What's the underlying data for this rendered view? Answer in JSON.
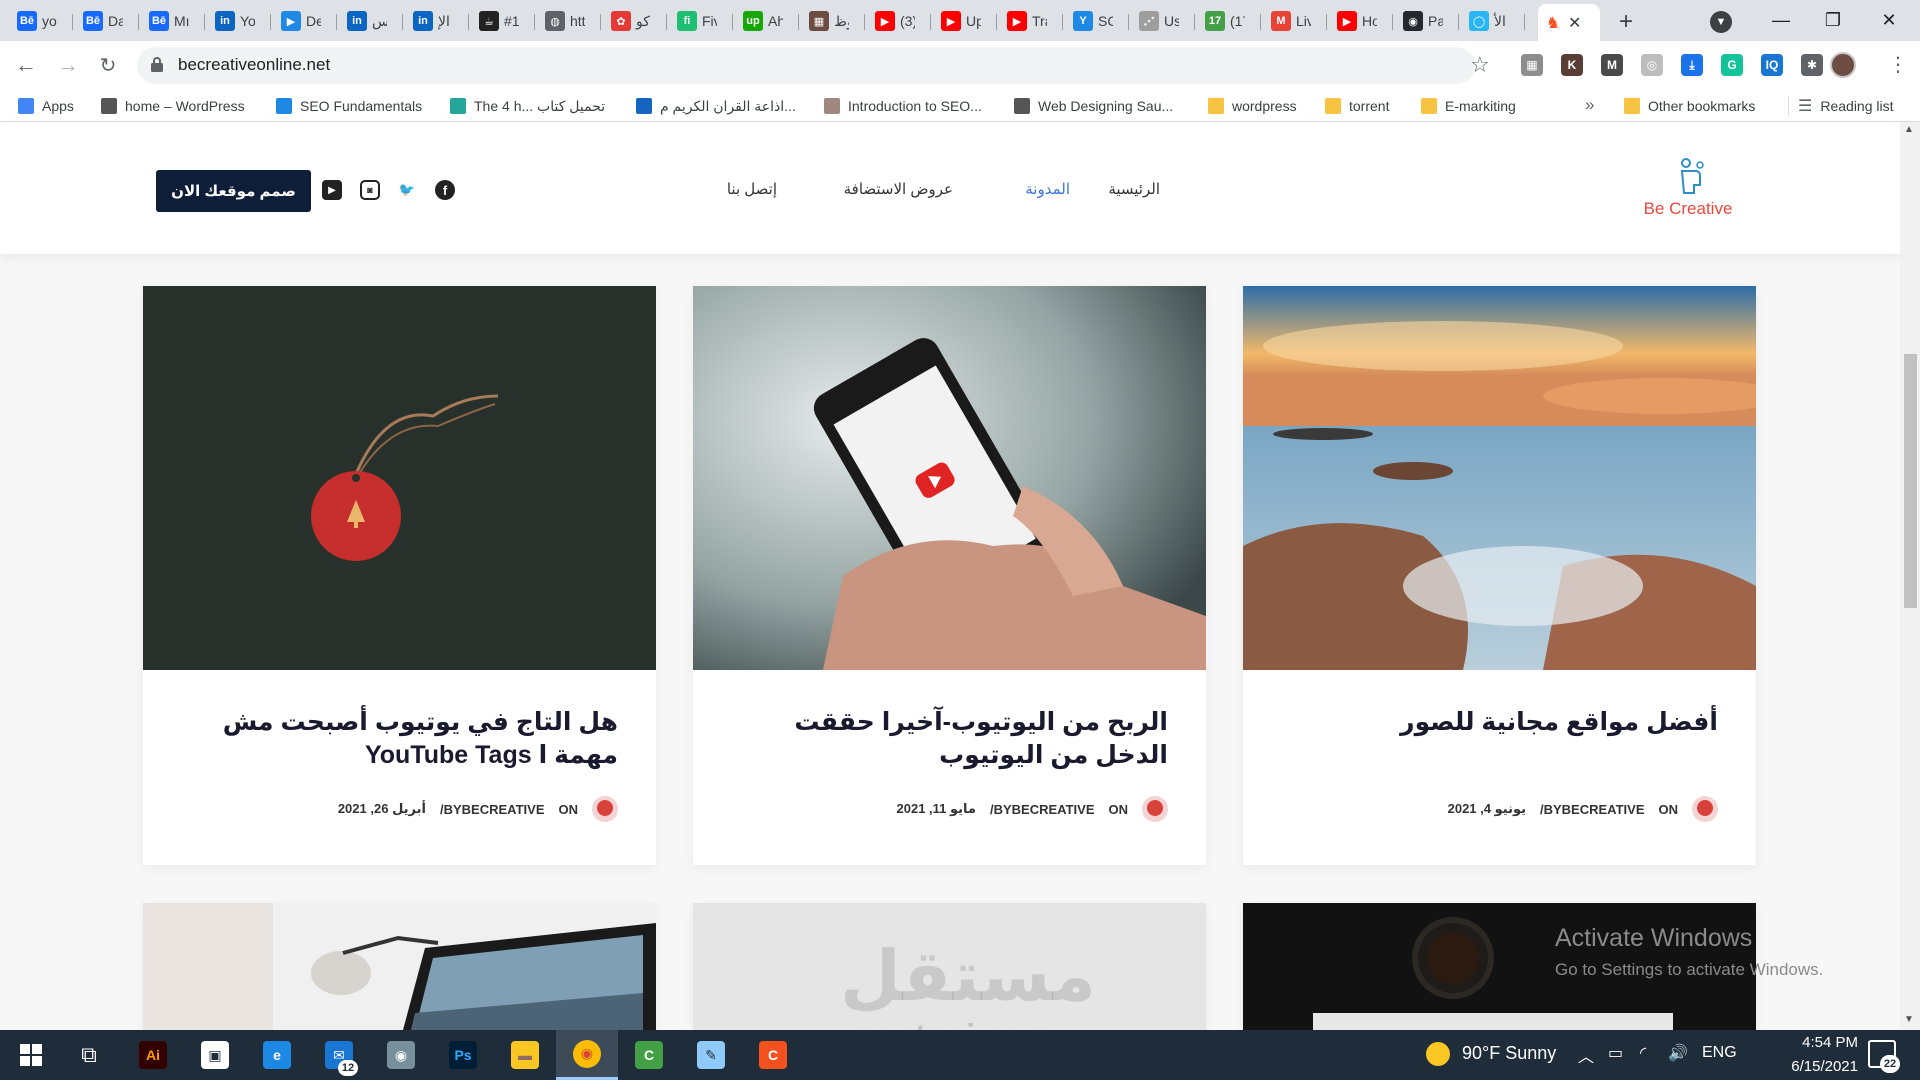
{
  "browser": {
    "tabs": [
      {
        "label": "yo",
        "icon": "behance-icon",
        "color": "#1769ff",
        "glyph": "Bē"
      },
      {
        "label": "Da",
        "icon": "behance-icon",
        "color": "#1769ff",
        "glyph": "Bē"
      },
      {
        "label": "Mı",
        "icon": "behance-icon",
        "color": "#1769ff",
        "glyph": "Bē"
      },
      {
        "label": "Yo",
        "icon": "linkedin-icon",
        "color": "#0a66c2",
        "glyph": "in"
      },
      {
        "label": "De",
        "icon": "video-icon",
        "color": "#1e88e5",
        "glyph": "▶"
      },
      {
        "label": "أس",
        "icon": "linkedin-icon",
        "color": "#0a66c2",
        "glyph": "in"
      },
      {
        "label": "الإ",
        "icon": "linkedin-icon",
        "color": "#0a66c2",
        "glyph": "in"
      },
      {
        "label": "#1",
        "icon": "mug-icon",
        "color": "#222222",
        "glyph": "☕"
      },
      {
        "label": "htt",
        "icon": "globe-icon",
        "color": "#5f6368",
        "glyph": "◍"
      },
      {
        "label": "كو",
        "icon": "gear-icon",
        "color": "#e53935",
        "glyph": "✿"
      },
      {
        "label": "Fiv",
        "icon": "fiverr-icon",
        "color": "#1dbf73",
        "glyph": "fi"
      },
      {
        "label": "Ah",
        "icon": "upwork-icon",
        "color": "#14a800",
        "glyph": "up"
      },
      {
        "label": "وظ",
        "icon": "badge-icon",
        "color": "#6d4c41",
        "glyph": "▦"
      },
      {
        "label": "(3)",
        "icon": "youtube-icon",
        "color": "#ff0000",
        "glyph": "▶"
      },
      {
        "label": "Up",
        "icon": "youtube-icon",
        "color": "#ff0000",
        "glyph": "▶"
      },
      {
        "label": "Tra",
        "icon": "youtube-icon",
        "color": "#ff0000",
        "glyph": "▶"
      },
      {
        "label": "SC",
        "icon": "bird-icon",
        "color": "#1e88e5",
        "glyph": "Y"
      },
      {
        "label": "Us",
        "icon": "loading-icon",
        "color": "#9e9e9e",
        "glyph": "⋰"
      },
      {
        "label": "(17",
        "icon": "whatsapp-icon",
        "color": "#43a047",
        "glyph": "17"
      },
      {
        "label": "Liv",
        "icon": "gmail-icon",
        "color": "#ea4335",
        "glyph": "M"
      },
      {
        "label": "Ho",
        "icon": "youtube-icon",
        "color": "#ff0000",
        "glyph": "▶"
      },
      {
        "label": "Pa",
        "icon": "github-icon",
        "color": "#24292e",
        "glyph": "◉"
      },
      {
        "label": "الأ",
        "icon": "circle-icon",
        "color": "#29b6f6",
        "glyph": "◯"
      }
    ],
    "active_tab": {
      "icon": "be-creative-icon",
      "close": "✕"
    },
    "new_tab": "+",
    "url": "becreativeonline.net",
    "bookmarks": [
      {
        "label": "Apps",
        "color": "#4285f4"
      },
      {
        "label": "home – WordPress",
        "color": "#555555"
      },
      {
        "label": "SEO Fundamentals",
        "color": "#1e88e5"
      },
      {
        "label": "The 4 h... تحميل كتاب",
        "color": "#26a69a"
      },
      {
        "label": "اذاعة القران الكريم م...",
        "color": "#1565c0"
      },
      {
        "label": "Introduction to SEO...",
        "color": "#a1887f"
      },
      {
        "label": "Web Designing Sau...",
        "color": "#555555"
      },
      {
        "label": "wordpress",
        "color": "#f6c343"
      },
      {
        "label": "torrent",
        "color": "#f6c343"
      },
      {
        "label": "E-markiting",
        "color": "#f6c343"
      }
    ],
    "more_bookmarks": "»",
    "other_bookmarks": "Other bookmarks",
    "reading_list": "Reading list",
    "extensions": [
      {
        "name": "ext-grid-icon",
        "color": "#8d8d8d",
        "glyph": "▦"
      },
      {
        "name": "ext-k-icon",
        "color": "#5a3e36",
        "glyph": "K"
      },
      {
        "name": "ext-m-icon",
        "color": "#4a4a4a",
        "glyph": "M"
      },
      {
        "name": "ext-ring-icon",
        "color": "#bdbdbd",
        "glyph": "◎"
      },
      {
        "name": "ext-download-icon",
        "color": "#1a73e8",
        "glyph": "⤓"
      },
      {
        "name": "grammarly-icon",
        "color": "#15c39a",
        "glyph": "G"
      },
      {
        "name": "ext-iq-icon",
        "color": "#1976d2",
        "glyph": "IQ"
      },
      {
        "name": "puzzle-icon",
        "color": "#5f6368",
        "glyph": "✱"
      }
    ]
  },
  "site": {
    "logo_text": "Be Creative",
    "nav": [
      "الرئيسية",
      "المدونة",
      "عروض الاستضافة",
      "إتصل بنا"
    ],
    "active_nav_color": "#3b73d9",
    "cta": "صمم موقعك الان",
    "social": [
      {
        "name": "facebook-icon",
        "glyph": "f"
      },
      {
        "name": "twitter-icon",
        "glyph": "🐦"
      },
      {
        "name": "instagram-icon",
        "glyph": "◙"
      },
      {
        "name": "youtube-icon",
        "glyph": "▶"
      }
    ],
    "posts": [
      {
        "title": "أفضل مواقع مجانية للصور",
        "on": "ON",
        "author": "BYBECREATIVE/",
        "date": "يونيو 4, 2021",
        "image": "seascape"
      },
      {
        "title": "الربح من اليوتيوب-آخيرا حققت الدخل من اليوتيوب",
        "on": "ON",
        "author": "BYBECREATIVE/",
        "date": "مايو 11, 2021",
        "image": "phone-youtube"
      },
      {
        "title": "هل التاج في يوتيوب أصبحت مش مهمة ا YouTube Tags",
        "on": "ON",
        "author": "BYBECREATIVE/",
        "date": "أبريل 26, 2021",
        "image": "red-tag"
      }
    ],
    "second_row": [
      "coffee-desk",
      "blank",
      "lamp-laptop"
    ]
  },
  "watermark": {
    "activate_title": "Activate Windows",
    "activate_sub": "Go to Settings to activate Windows.",
    "site_ar": "مستقل",
    "site_en": "mostaqi.com"
  },
  "taskbar": {
    "apps": [
      {
        "name": "illustrator-icon",
        "color": "#300",
        "glyph": "Ai",
        "fg": "#ff9a00"
      },
      {
        "name": "store-icon",
        "color": "#ffffff",
        "glyph": "▣",
        "fg": "#1f2c3a"
      },
      {
        "name": "edge-icon",
        "color": "#1e88e5",
        "glyph": "e",
        "fg": "#ffffff"
      },
      {
        "name": "mail-icon",
        "color": "#1976d2",
        "glyph": "✉",
        "fg": "#ffffff"
      },
      {
        "name": "camera-icon",
        "color": "#78909c",
        "glyph": "◉",
        "fg": "#ffffff"
      },
      {
        "name": "photoshop-icon",
        "color": "#001e36",
        "glyph": "Ps",
        "fg": "#31a8ff"
      },
      {
        "name": "file-explorer-icon",
        "color": "#f9c623",
        "glyph": "▬",
        "fg": "#8d6e63"
      },
      {
        "name": "chrome-icon",
        "color": "#fbbc05",
        "glyph": "◉",
        "fg": "#db4437"
      },
      {
        "name": "camtasia-icon",
        "color": "#43a047",
        "glyph": "C",
        "fg": "#ffffff"
      },
      {
        "name": "notepad-icon",
        "color": "#90caf9",
        "glyph": "✎",
        "fg": "#1f2c3a"
      },
      {
        "name": "camtasia-recorder-icon",
        "color": "#f4511e",
        "glyph": "C",
        "fg": "#ffffff"
      }
    ],
    "mail_badge": "12",
    "weather": "90°F  Sunny",
    "lang": "ENG",
    "time": "4:54 PM",
    "date": "6/15/2021",
    "notifications": "22"
  }
}
